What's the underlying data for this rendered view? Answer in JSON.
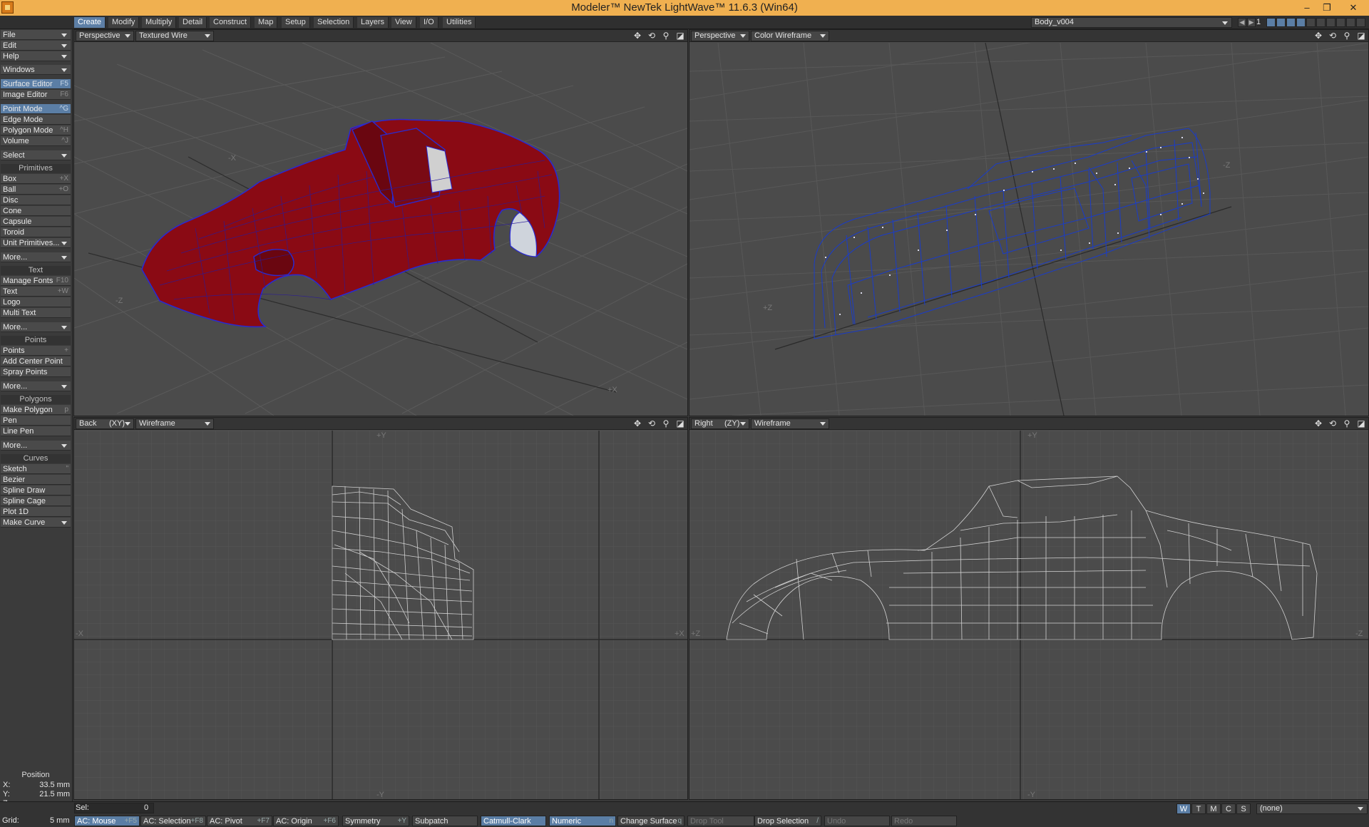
{
  "window": {
    "title": "Modeler™ NewTek LightWave™ 11.6.3 (Win64)",
    "controls": [
      "–",
      "❐",
      "✕"
    ]
  },
  "menu_tabs": [
    "Create",
    "Modify",
    "Multiply",
    "Detail",
    "Construct",
    "Map",
    "Setup",
    "Selection",
    "Layers",
    "View",
    "I/O",
    "Utilities"
  ],
  "layer": {
    "name": "Body_v004",
    "number": "1"
  },
  "toolbar": {
    "dropdowns": [
      "File",
      "Edit",
      "Help"
    ],
    "windows": "Windows",
    "editors": [
      {
        "label": "Surface Editor",
        "shortcut": "F5"
      },
      {
        "label": "Image Editor",
        "shortcut": "F6"
      }
    ],
    "modes": [
      {
        "label": "Point Mode",
        "shortcut": "^G"
      },
      {
        "label": "Edge Mode",
        "shortcut": ""
      },
      {
        "label": "Polygon Mode",
        "shortcut": "^H"
      },
      {
        "label": "Volume",
        "shortcut": "^J"
      }
    ],
    "select": "Select",
    "primitives_head": "Primitives",
    "primitives": [
      {
        "label": "Box",
        "shortcut": "+X"
      },
      {
        "label": "Ball",
        "shortcut": "+O"
      },
      {
        "label": "Disc",
        "shortcut": ""
      },
      {
        "label": "Cone",
        "shortcut": ""
      },
      {
        "label": "Capsule",
        "shortcut": ""
      },
      {
        "label": "Toroid",
        "shortcut": ""
      },
      {
        "label": "Unit Primitives...",
        "shortcut": ""
      }
    ],
    "more": "More...",
    "text_head": "Text",
    "text_items": [
      {
        "label": "Manage Fonts",
        "shortcut": "F10"
      },
      {
        "label": "Text",
        "shortcut": "+W"
      },
      {
        "label": "Logo",
        "shortcut": ""
      },
      {
        "label": "Multi Text",
        "shortcut": ""
      }
    ],
    "points_head": "Points",
    "points_items": [
      {
        "label": "Points",
        "shortcut": "+"
      },
      {
        "label": "Add Center Point",
        "shortcut": ""
      },
      {
        "label": "Spray Points",
        "shortcut": ""
      }
    ],
    "polygons_head": "Polygons",
    "polygons_items": [
      {
        "label": "Make Polygon",
        "shortcut": "p"
      },
      {
        "label": "Pen",
        "shortcut": ""
      },
      {
        "label": "Line Pen",
        "shortcut": ""
      }
    ],
    "curves_head": "Curves",
    "curves_items": [
      {
        "label": "Sketch",
        "shortcut": "\""
      },
      {
        "label": "Bezier",
        "shortcut": ""
      },
      {
        "label": "Spline Draw",
        "shortcut": ""
      },
      {
        "label": "Spline Cage",
        "shortcut": ""
      },
      {
        "label": "Plot 1D",
        "shortcut": ""
      }
    ],
    "make_curve": "Make Curve"
  },
  "position": {
    "title": "Position",
    "x_label": "X:",
    "x_val": "33.5 mm",
    "y_label": "Y:",
    "y_val": "21.5 mm",
    "z_label": "Z:",
    "z_val": ""
  },
  "viewports": [
    {
      "view": "Perspective",
      "axis": "",
      "mode": "Textured Wire"
    },
    {
      "view": "Perspective",
      "axis": "",
      "mode": "Color Wireframe"
    },
    {
      "view": "Back",
      "axis": "(XY)",
      "mode": "Wireframe"
    },
    {
      "view": "Right",
      "axis": "(ZY)",
      "mode": "Wireframe"
    }
  ],
  "axis_labels": {
    "tl": [
      "-X",
      "+X",
      "-Z"
    ],
    "tr": [
      "+Z",
      "-Z"
    ],
    "bl": [
      "+Y",
      "-X",
      "+X",
      "-Y"
    ],
    "br": [
      "+Y",
      "+Z",
      "-Z",
      "-Y"
    ]
  },
  "status": {
    "sel_label": "Sel:",
    "sel_val": "0",
    "wtmcs": [
      "W",
      "T",
      "M",
      "C",
      "S"
    ],
    "surface": "(none)",
    "grid_label": "Grid:",
    "grid_val": "5 mm",
    "buttons": [
      {
        "label": "AC: Mouse",
        "shortcut": "+F5"
      },
      {
        "label": "AC: Selection",
        "shortcut": "+F8"
      },
      {
        "label": "AC: Pivot",
        "shortcut": "+F7"
      },
      {
        "label": "AC: Origin",
        "shortcut": "+F6"
      },
      {
        "label": "Symmetry",
        "shortcut": "+Y"
      },
      {
        "label": "Subpatch",
        "shortcut": ""
      },
      {
        "label": "Catmull-Clark",
        "shortcut": ""
      },
      {
        "label": "Numeric",
        "shortcut": "n"
      },
      {
        "label": "Change Surface",
        "shortcut": "q"
      },
      {
        "label": "Drop Tool",
        "shortcut": ""
      },
      {
        "label": "Drop Selection",
        "shortcut": "/"
      },
      {
        "label": "Undo",
        "shortcut": ""
      },
      {
        "label": "Redo",
        "shortcut": ""
      }
    ]
  },
  "colors": {
    "accent": "#5b7ea5",
    "title_bar": "#f0b050",
    "car_body": "#8a0a14",
    "wire_blue": "#1a3cc8",
    "wire_gray": "#cfcfcf"
  }
}
